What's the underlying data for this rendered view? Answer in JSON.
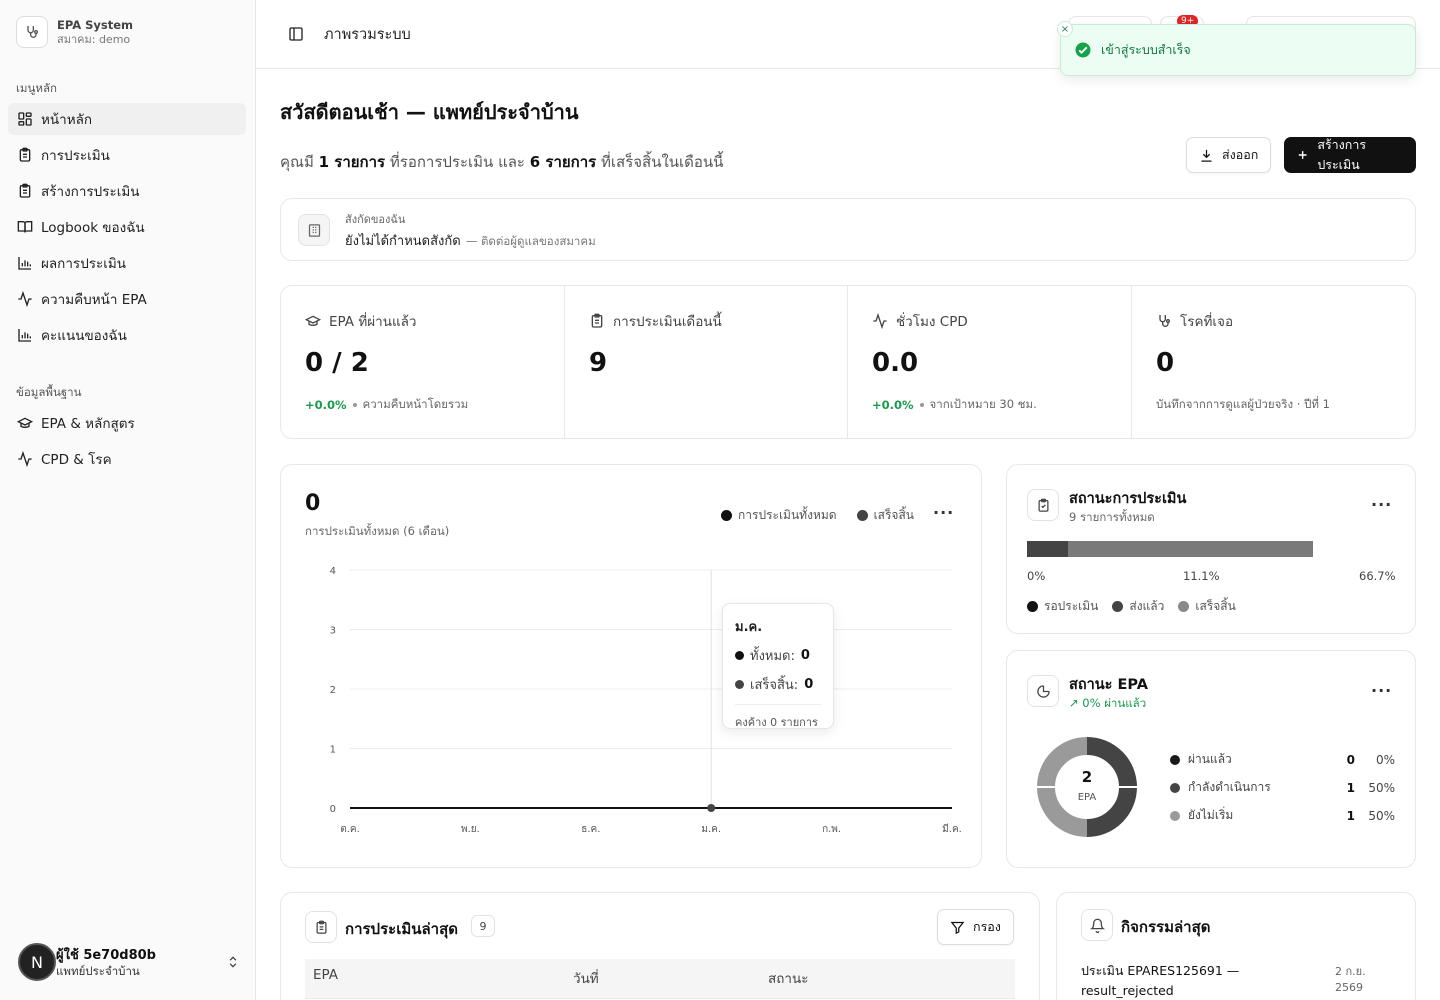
{
  "brand": {
    "name": "EPA System",
    "sub": "สมาคม: demo"
  },
  "sidebar": {
    "group_main": "เมนูหลัก",
    "group_base": "ข้อมูลพื้นฐาน",
    "items": [
      {
        "label": "หน้าหลัก",
        "icon": "dashboard-icon"
      },
      {
        "label": "การประเมิน",
        "icon": "clipboard-icon"
      },
      {
        "label": "สร้างการประเมิน",
        "icon": "clipboard-plus-icon"
      },
      {
        "label": "Logbook ของฉัน",
        "icon": "book-open-icon"
      },
      {
        "label": "ผลการประเมิน",
        "icon": "bar-chart-icon"
      },
      {
        "label": "ความคืบหน้า EPA",
        "icon": "activity-icon"
      },
      {
        "label": "คะแนนของฉัน",
        "icon": "bar-chart-icon"
      },
      {
        "label": "EPA & หลักสูตร",
        "icon": "graduation-cap-icon"
      },
      {
        "label": "CPD & โรค",
        "icon": "activity-icon"
      }
    ]
  },
  "user": {
    "initial": "N",
    "name": "ผู้ใช้ 5e70d80b",
    "role": "แพทย์ประจำบ้าน"
  },
  "header": {
    "breadcrumb": "ภาพรวมระบบ",
    "notif_badge": "9+"
  },
  "toast": {
    "message": "เข้าสู่ระบบสำเร็จ",
    "close": "×"
  },
  "page": {
    "title": "สวัสดีตอนเช้า — แพทย์ประจำบ้าน",
    "summary": {
      "prefix": "คุณมี ",
      "pending": "1 รายการ",
      "mid": " ที่รอการประเมิน และ ",
      "done": "6 รายการ",
      "suffix": " ที่เสร็จสิ้นในเดือนนี้"
    },
    "export_label": "ส่งออก",
    "create_label": "สร้างการประเมิน"
  },
  "affiliation": {
    "label": "สังกัดของฉัน",
    "value": "ยังไม่ได้กำหนดสังกัด",
    "hint": "— ติดต่อผู้ดูแลของสมาคม"
  },
  "stats": [
    {
      "label": "EPA ที่ผ่านแล้ว",
      "value": "0 / 2",
      "delta": "+0.0%",
      "note": "ความคืบหน้าโดยรวม"
    },
    {
      "label": "การประเมินเดือนนี้",
      "value": "9",
      "delta": "",
      "note": ""
    },
    {
      "label": "ชั่วโมง CPD",
      "value": "0.0",
      "delta": "+0.0%",
      "note": "จากเป้าหมาย 30 ชม."
    },
    {
      "label": "โรคที่เจอ",
      "value": "0",
      "delta": "",
      "note": "บันทึกจากการดูแลผู้ป่วยจริง · ปีที่ 1"
    }
  ],
  "chart_card": {
    "total": "0",
    "subtitle": "การประเมินทั้งหมด (6 เดือน)",
    "legend": [
      "การประเมินทั้งหมด",
      "เสร็จสิ้น"
    ]
  },
  "chart_data": {
    "type": "line",
    "categories": [
      "ต.ค.",
      "พ.ย.",
      "ธ.ค.",
      "ม.ค.",
      "ก.พ.",
      "มี.ค."
    ],
    "series": [
      {
        "name": "การประเมินทั้งหมด",
        "values": [
          0,
          0,
          0,
          0,
          0,
          0
        ]
      },
      {
        "name": "เสร็จสิ้น",
        "values": [
          0,
          0,
          0,
          0,
          0,
          0
        ]
      }
    ],
    "ylim": [
      0,
      4
    ],
    "yticks": [
      "0",
      "1",
      "2",
      "3",
      "4"
    ],
    "grid": true,
    "legend": "top-right"
  },
  "tooltip": {
    "month": "ม.ค.",
    "total_label": "ทั้งหมด:",
    "total": "0",
    "done_label": "เสร็จสิ้น:",
    "done": "0",
    "pending": "คงค้าง 0 รายการ"
  },
  "status_card": {
    "title": "สถานะการประเมิน",
    "subtitle": "9 รายการทั้งหมด",
    "bar_segments": [
      0.111,
      0.667
    ],
    "ticks": [
      "0%",
      "11.1%",
      "66.7%"
    ],
    "legend": [
      "รอประเมิน",
      "ส่งแล้ว",
      "เสร็จสิ้น"
    ]
  },
  "epa_card": {
    "title": "สถานะ EPA",
    "trend": "0% ผ่านแล้ว",
    "center_value": "2",
    "center_label": "EPA",
    "items": [
      {
        "name": "ผ่านแล้ว",
        "count": "0",
        "pct": "0%",
        "color": "#1a1a1a",
        "frac": 0
      },
      {
        "name": "กำลังดำเนินการ",
        "count": "1",
        "pct": "50%",
        "color": "#444444",
        "frac": 0.5
      },
      {
        "name": "ยังไม่เริ่ม",
        "count": "1",
        "pct": "50%",
        "color": "#9a9a9a",
        "frac": 0.5
      }
    ]
  },
  "recent": {
    "title": "การประเมินล่าสุด",
    "count": "9",
    "filter_label": "กรอง",
    "columns": [
      "EPA",
      "วันที่",
      "สถานะ"
    ]
  },
  "activity": {
    "title": "กิจกรรมล่าสุด",
    "item_title": "ประเมิน EPARES125691 — result_rejected",
    "item_date": "2 ก.ย. 2569"
  },
  "colors": {
    "accent_dark": "#111111",
    "success": "#189a4d",
    "toast_bg": "#ecfdf3"
  }
}
